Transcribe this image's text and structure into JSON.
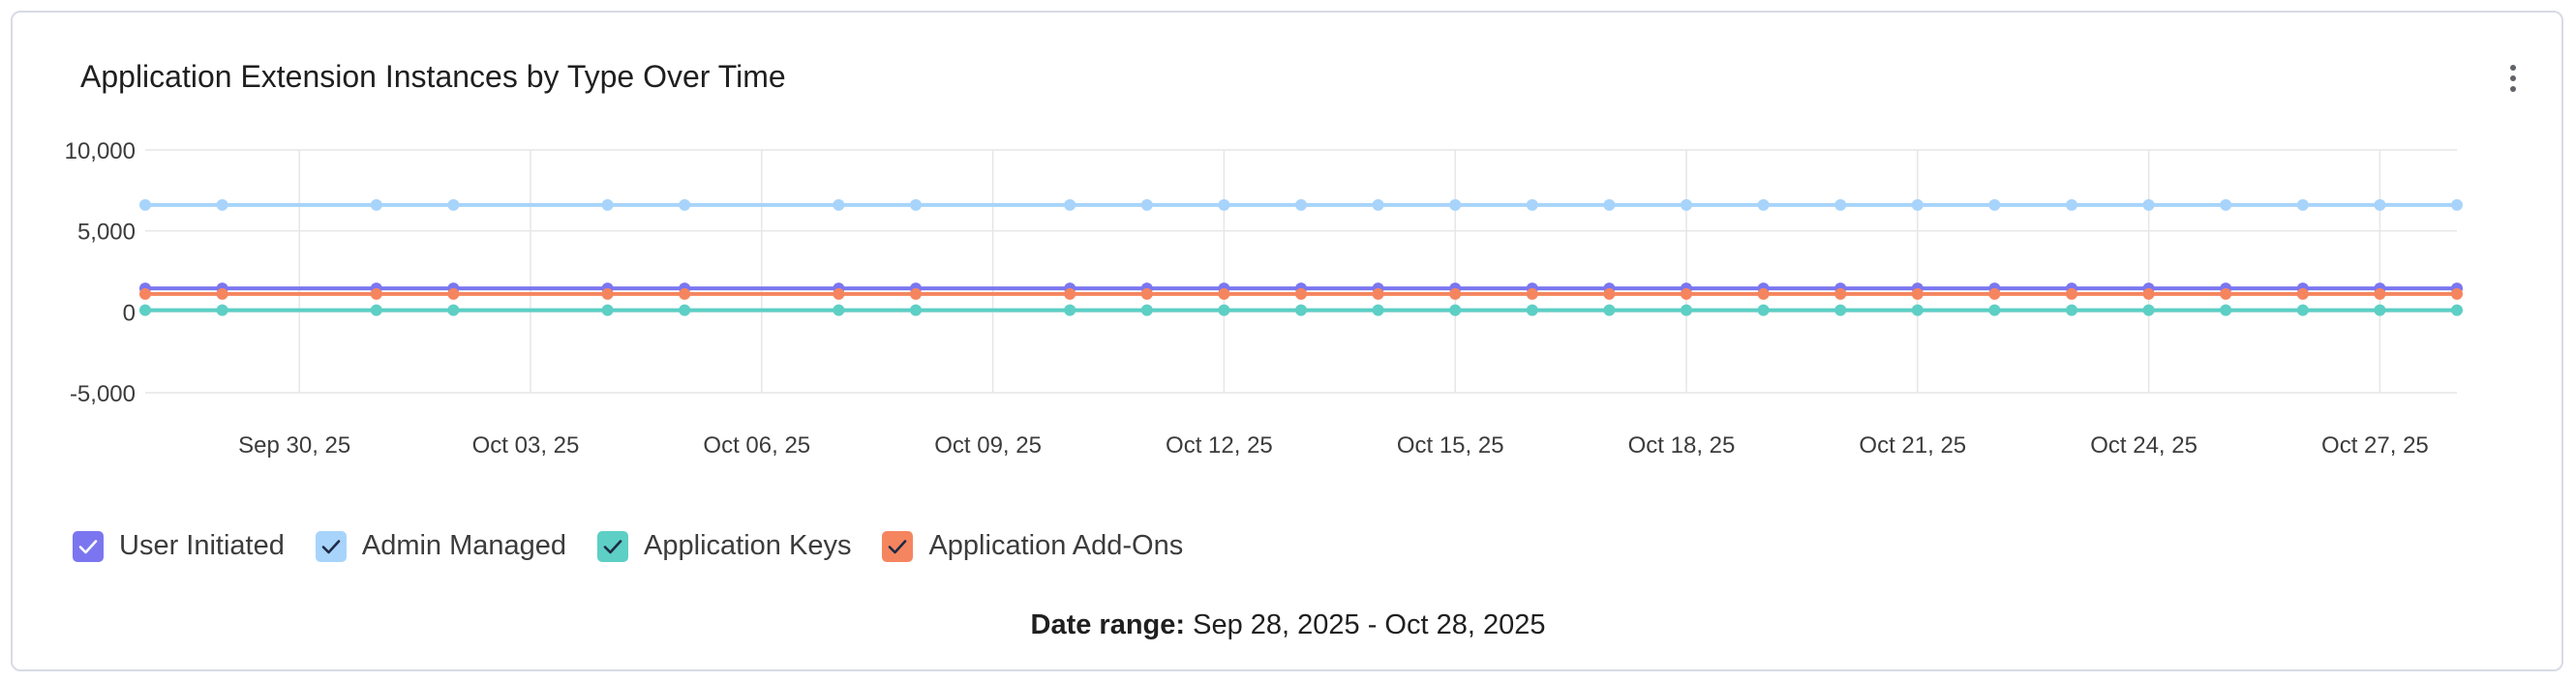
{
  "header": {
    "title": "Application Extension Instances by Type Over Time"
  },
  "footer": {
    "date_range_label": "Date range:",
    "date_range_value": "Sep 28, 2025 - Oct 28, 2025"
  },
  "chart_data": {
    "type": "line",
    "title": "Application Extension Instances by Type Over Time",
    "xlabel": "",
    "ylabel": "",
    "ylim": [
      -5000,
      10000
    ],
    "y_ticks": [
      "10,000",
      "5,000",
      "0",
      "-5,000"
    ],
    "y_tick_values": [
      10000,
      5000,
      0,
      -5000
    ],
    "x_tick_labels": [
      "Sep 30, 25",
      "Oct 03, 25",
      "Oct 06, 25",
      "Oct 09, 25",
      "Oct 12, 25",
      "Oct 15, 25",
      "Oct 18, 25",
      "Oct 21, 25",
      "Oct 24, 25",
      "Oct 27, 25"
    ],
    "x_start": "2025-09-28",
    "x_end": "2025-10-28",
    "x_tick_dates": [
      "2025-09-30",
      "2025-10-03",
      "2025-10-06",
      "2025-10-09",
      "2025-10-12",
      "2025-10-15",
      "2025-10-18",
      "2025-10-21",
      "2025-10-24",
      "2025-10-27"
    ],
    "point_dates": [
      "2025-09-28",
      "2025-09-29",
      "2025-10-01",
      "2025-10-02",
      "2025-10-04",
      "2025-10-05",
      "2025-10-07",
      "2025-10-08",
      "2025-10-10",
      "2025-10-11",
      "2025-10-12",
      "2025-10-13",
      "2025-10-14",
      "2025-10-15",
      "2025-10-16",
      "2025-10-17",
      "2025-10-18",
      "2025-10-19",
      "2025-10-20",
      "2025-10-21",
      "2025-10-22",
      "2025-10-23",
      "2025-10-24",
      "2025-10-25",
      "2025-10-26",
      "2025-10-27",
      "2025-10-28"
    ],
    "grid": true,
    "legend_position": "bottom-left",
    "series": [
      {
        "name": "User Initiated",
        "color": "#7b76f0",
        "value": 1450
      },
      {
        "name": "Admin Managed",
        "color": "#a8d4fb",
        "value": 6600
      },
      {
        "name": "Application Keys",
        "color": "#5dcfc5",
        "value": 100
      },
      {
        "name": "Application Add-Ons",
        "color": "#f5855f",
        "value": 1100
      }
    ]
  },
  "icons": {
    "menu": "more-vertical-icon",
    "check": "check-icon"
  }
}
